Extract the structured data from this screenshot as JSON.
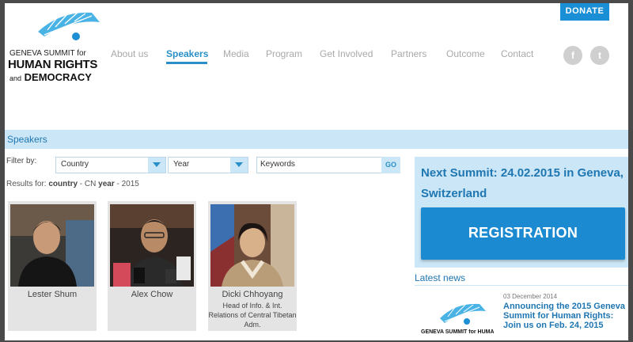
{
  "header": {
    "logo": {
      "line1": "GENEVA SUMMIT for",
      "line2": "HUMAN RIGHTS",
      "line3_small": "and",
      "line3": "DEMOCRACY"
    },
    "nav": [
      "About us",
      "Speakers",
      "Media",
      "Program",
      "Get Involved",
      "Partners",
      "Outcome",
      "Contact"
    ],
    "active_nav": "Speakers",
    "donate_label": "DONATE",
    "social": {
      "facebook": "f",
      "twitter": "t"
    }
  },
  "speakers_section": {
    "title": "Speakers"
  },
  "filter": {
    "label": "Filter by:",
    "country_select": "Country",
    "year_select": "Year",
    "keywords_placeholder": "Keywords",
    "go_label": "GO",
    "results_prefix": "Results for:",
    "results_country_label": "country",
    "results_country_value": "CN",
    "results_year_label": "year",
    "results_year_value": "2015"
  },
  "speakers": [
    {
      "name": "Lester Shum",
      "role": ""
    },
    {
      "name": "Alex Chow",
      "role": ""
    },
    {
      "name": "Dicki Chhoyang",
      "role": "Head of Info. & Int. Relations of Central Tibetan Adm."
    }
  ],
  "next_summit": {
    "title": "Next Summit: 24.02.2015 in Geneva, Switzerland",
    "button_label": "REGISTRATION"
  },
  "latest_news": {
    "heading": "Latest news",
    "date": "03 December 2014",
    "title": "Announcing the 2015 Geneva Summit for Human Rights: Join us on Feb. 24, 2015",
    "logo_text": "GENEVA SUMMIT for HUMAN RIGHTS"
  },
  "colors": {
    "accent": "#2a8fc7",
    "light_accent": "#cbe7f7",
    "button": "#1b8ad0"
  }
}
